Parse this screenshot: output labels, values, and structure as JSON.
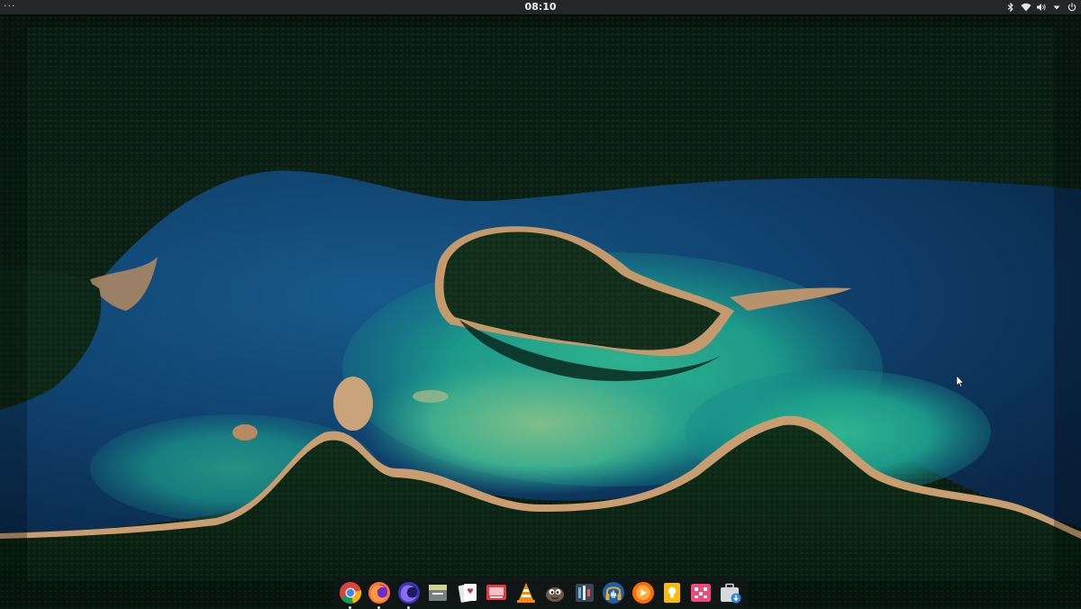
{
  "panel": {
    "menu_glyph": "···",
    "clock": "08:10",
    "tray": [
      {
        "icon": "bluetooth-icon"
      },
      {
        "icon": "wifi-icon"
      },
      {
        "icon": "volume-icon"
      },
      {
        "icon": "dropdown-arrow-icon"
      },
      {
        "icon": "power-icon"
      }
    ]
  },
  "dock": {
    "apps": [
      {
        "icon": "chrome-icon",
        "running": true
      },
      {
        "icon": "firefox-icon",
        "running": true
      },
      {
        "icon": "firefox-nightly-icon",
        "running": true
      },
      {
        "icon": "file-manager-icon",
        "running": false
      },
      {
        "icon": "solitaire-cards-icon",
        "running": false
      },
      {
        "icon": "screen-recorder-icon",
        "running": false
      },
      {
        "icon": "vlc-icon",
        "running": false
      },
      {
        "icon": "gimp-icon",
        "running": false
      },
      {
        "icon": "kdenlive-icon",
        "running": false
      },
      {
        "icon": "audacity-icon",
        "running": false
      },
      {
        "icon": "google-play-music-icon",
        "running": false
      },
      {
        "icon": "google-keep-icon",
        "running": false
      },
      {
        "icon": "rubiks-puzzle-icon",
        "running": false
      },
      {
        "icon": "software-store-icon",
        "running": false
      }
    ]
  },
  "colors": {
    "panel_bg": "#232729",
    "forest": "#0d2315",
    "deep_water": "#0f3a66",
    "shallow_water": "#1fa391",
    "sand": "#c79a6a"
  }
}
